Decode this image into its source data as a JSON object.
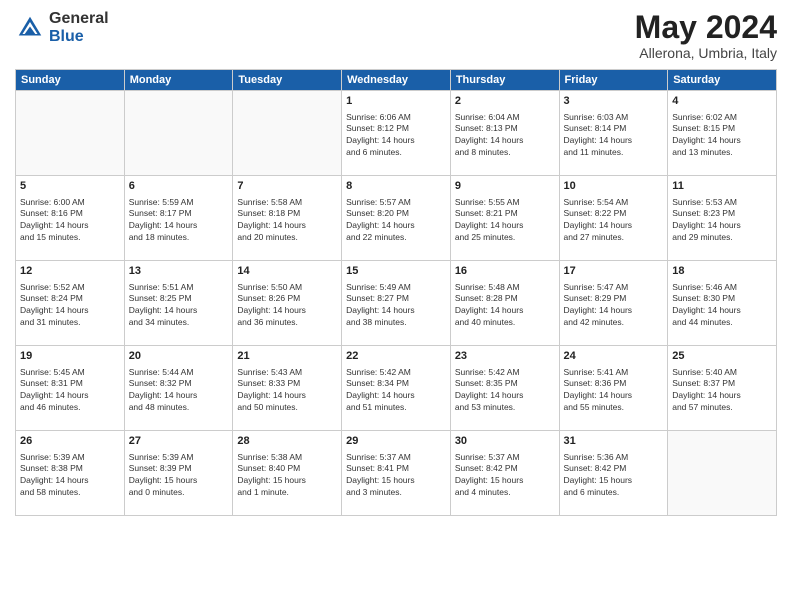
{
  "header": {
    "logo_general": "General",
    "logo_blue": "Blue",
    "month_year": "May 2024",
    "location": "Allerona, Umbria, Italy"
  },
  "weekdays": [
    "Sunday",
    "Monday",
    "Tuesday",
    "Wednesday",
    "Thursday",
    "Friday",
    "Saturday"
  ],
  "weeks": [
    [
      {
        "day": "",
        "info": ""
      },
      {
        "day": "",
        "info": ""
      },
      {
        "day": "",
        "info": ""
      },
      {
        "day": "1",
        "info": "Sunrise: 6:06 AM\nSunset: 8:12 PM\nDaylight: 14 hours\nand 6 minutes."
      },
      {
        "day": "2",
        "info": "Sunrise: 6:04 AM\nSunset: 8:13 PM\nDaylight: 14 hours\nand 8 minutes."
      },
      {
        "day": "3",
        "info": "Sunrise: 6:03 AM\nSunset: 8:14 PM\nDaylight: 14 hours\nand 11 minutes."
      },
      {
        "day": "4",
        "info": "Sunrise: 6:02 AM\nSunset: 8:15 PM\nDaylight: 14 hours\nand 13 minutes."
      }
    ],
    [
      {
        "day": "5",
        "info": "Sunrise: 6:00 AM\nSunset: 8:16 PM\nDaylight: 14 hours\nand 15 minutes."
      },
      {
        "day": "6",
        "info": "Sunrise: 5:59 AM\nSunset: 8:17 PM\nDaylight: 14 hours\nand 18 minutes."
      },
      {
        "day": "7",
        "info": "Sunrise: 5:58 AM\nSunset: 8:18 PM\nDaylight: 14 hours\nand 20 minutes."
      },
      {
        "day": "8",
        "info": "Sunrise: 5:57 AM\nSunset: 8:20 PM\nDaylight: 14 hours\nand 22 minutes."
      },
      {
        "day": "9",
        "info": "Sunrise: 5:55 AM\nSunset: 8:21 PM\nDaylight: 14 hours\nand 25 minutes."
      },
      {
        "day": "10",
        "info": "Sunrise: 5:54 AM\nSunset: 8:22 PM\nDaylight: 14 hours\nand 27 minutes."
      },
      {
        "day": "11",
        "info": "Sunrise: 5:53 AM\nSunset: 8:23 PM\nDaylight: 14 hours\nand 29 minutes."
      }
    ],
    [
      {
        "day": "12",
        "info": "Sunrise: 5:52 AM\nSunset: 8:24 PM\nDaylight: 14 hours\nand 31 minutes."
      },
      {
        "day": "13",
        "info": "Sunrise: 5:51 AM\nSunset: 8:25 PM\nDaylight: 14 hours\nand 34 minutes."
      },
      {
        "day": "14",
        "info": "Sunrise: 5:50 AM\nSunset: 8:26 PM\nDaylight: 14 hours\nand 36 minutes."
      },
      {
        "day": "15",
        "info": "Sunrise: 5:49 AM\nSunset: 8:27 PM\nDaylight: 14 hours\nand 38 minutes."
      },
      {
        "day": "16",
        "info": "Sunrise: 5:48 AM\nSunset: 8:28 PM\nDaylight: 14 hours\nand 40 minutes."
      },
      {
        "day": "17",
        "info": "Sunrise: 5:47 AM\nSunset: 8:29 PM\nDaylight: 14 hours\nand 42 minutes."
      },
      {
        "day": "18",
        "info": "Sunrise: 5:46 AM\nSunset: 8:30 PM\nDaylight: 14 hours\nand 44 minutes."
      }
    ],
    [
      {
        "day": "19",
        "info": "Sunrise: 5:45 AM\nSunset: 8:31 PM\nDaylight: 14 hours\nand 46 minutes."
      },
      {
        "day": "20",
        "info": "Sunrise: 5:44 AM\nSunset: 8:32 PM\nDaylight: 14 hours\nand 48 minutes."
      },
      {
        "day": "21",
        "info": "Sunrise: 5:43 AM\nSunset: 8:33 PM\nDaylight: 14 hours\nand 50 minutes."
      },
      {
        "day": "22",
        "info": "Sunrise: 5:42 AM\nSunset: 8:34 PM\nDaylight: 14 hours\nand 51 minutes."
      },
      {
        "day": "23",
        "info": "Sunrise: 5:42 AM\nSunset: 8:35 PM\nDaylight: 14 hours\nand 53 minutes."
      },
      {
        "day": "24",
        "info": "Sunrise: 5:41 AM\nSunset: 8:36 PM\nDaylight: 14 hours\nand 55 minutes."
      },
      {
        "day": "25",
        "info": "Sunrise: 5:40 AM\nSunset: 8:37 PM\nDaylight: 14 hours\nand 57 minutes."
      }
    ],
    [
      {
        "day": "26",
        "info": "Sunrise: 5:39 AM\nSunset: 8:38 PM\nDaylight: 14 hours\nand 58 minutes."
      },
      {
        "day": "27",
        "info": "Sunrise: 5:39 AM\nSunset: 8:39 PM\nDaylight: 15 hours\nand 0 minutes."
      },
      {
        "day": "28",
        "info": "Sunrise: 5:38 AM\nSunset: 8:40 PM\nDaylight: 15 hours\nand 1 minute."
      },
      {
        "day": "29",
        "info": "Sunrise: 5:37 AM\nSunset: 8:41 PM\nDaylight: 15 hours\nand 3 minutes."
      },
      {
        "day": "30",
        "info": "Sunrise: 5:37 AM\nSunset: 8:42 PM\nDaylight: 15 hours\nand 4 minutes."
      },
      {
        "day": "31",
        "info": "Sunrise: 5:36 AM\nSunset: 8:42 PM\nDaylight: 15 hours\nand 6 minutes."
      },
      {
        "day": "",
        "info": ""
      }
    ]
  ]
}
